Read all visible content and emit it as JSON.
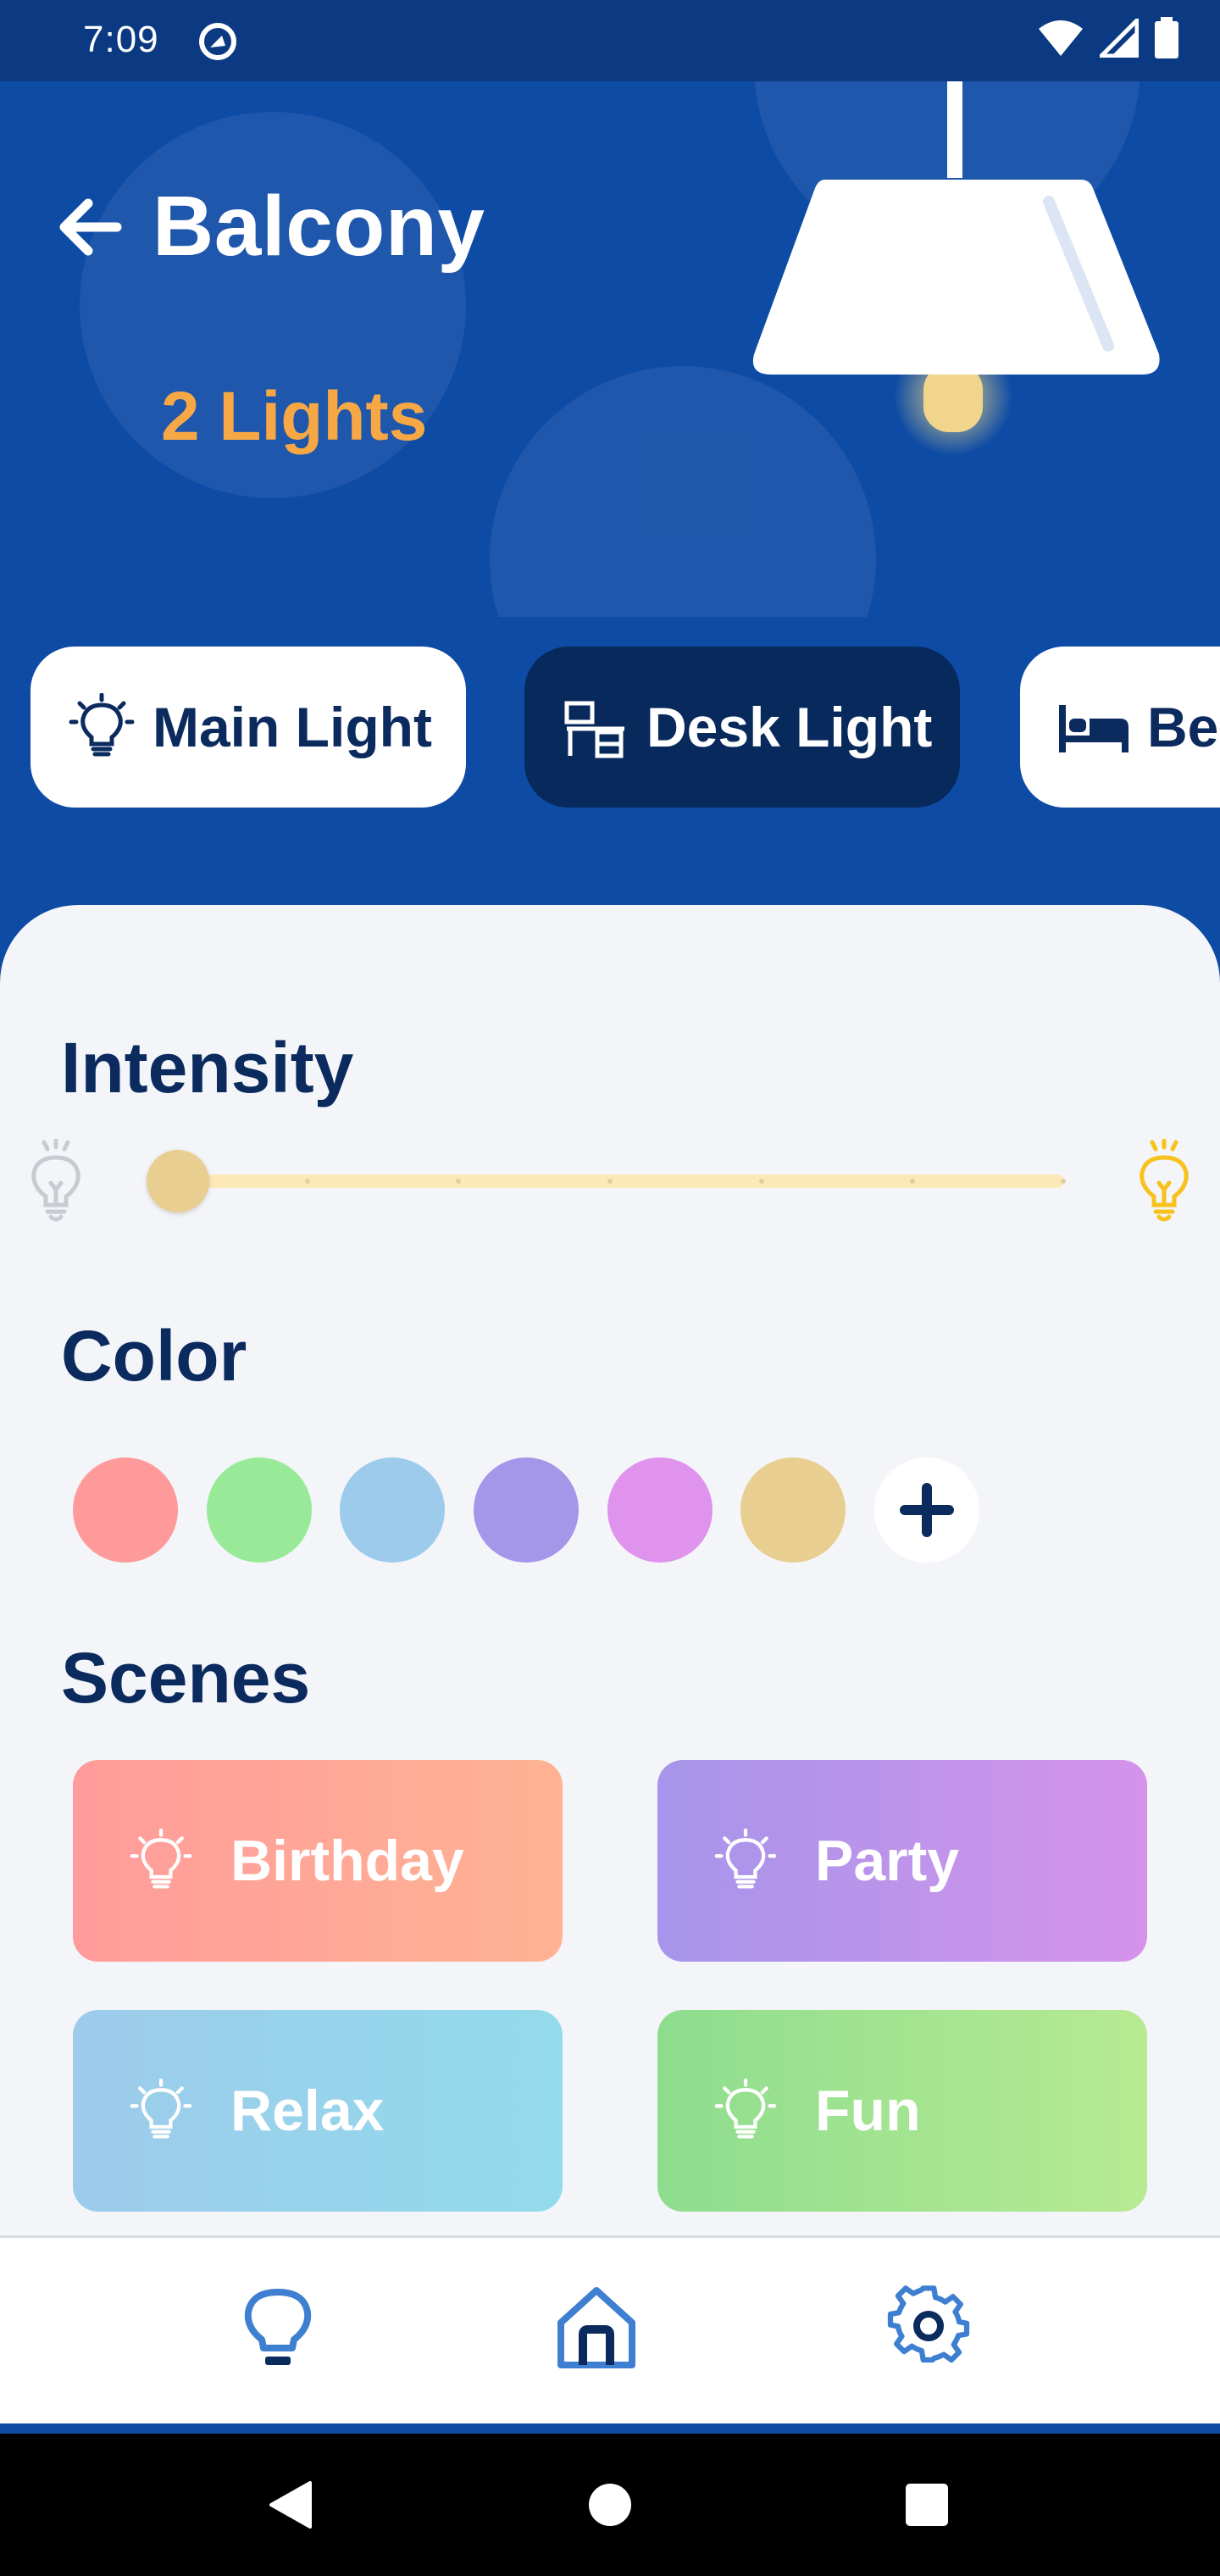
{
  "status_bar": {
    "time": "7:09"
  },
  "header": {
    "title": "Balcony",
    "lights_count": "2 Lights"
  },
  "devices": [
    {
      "label": "Main Light",
      "icon": "lightbulb-icon",
      "active": false
    },
    {
      "label": "Desk Light",
      "icon": "desk-icon",
      "active": true
    },
    {
      "label": "Be",
      "icon": "bed-icon",
      "active": false
    }
  ],
  "intensity": {
    "title": "Intensity",
    "level": 0.03
  },
  "color": {
    "title": "Color",
    "swatches": [
      "#ff9a9a",
      "#98ea98",
      "#9ccbeb",
      "#a496e9",
      "#df93ec",
      "#e8cf91"
    ],
    "add_icon": "plus-icon"
  },
  "scenes": {
    "title": "Scenes",
    "items": [
      {
        "label": "Birthday",
        "from": "#ff9b9b",
        "to": "#ffb393"
      },
      {
        "label": "Party",
        "from": "#a595ea",
        "to": "#d593ea"
      },
      {
        "label": "Relax",
        "from": "#9ccbeb",
        "to": "#93dbeb"
      },
      {
        "label": "Fun",
        "from": "#8edd8e",
        "to": "#b7ea93"
      }
    ]
  },
  "bottom_nav": [
    {
      "name": "lightbulb-icon"
    },
    {
      "name": "home-icon"
    },
    {
      "name": "settings-gear-icon"
    }
  ],
  "colors": {
    "header_bg": "#0d4ba5",
    "accent_orange": "#f7a845",
    "text_navy": "#0b2a5e",
    "sheet_bg": "#f4f5f9"
  }
}
